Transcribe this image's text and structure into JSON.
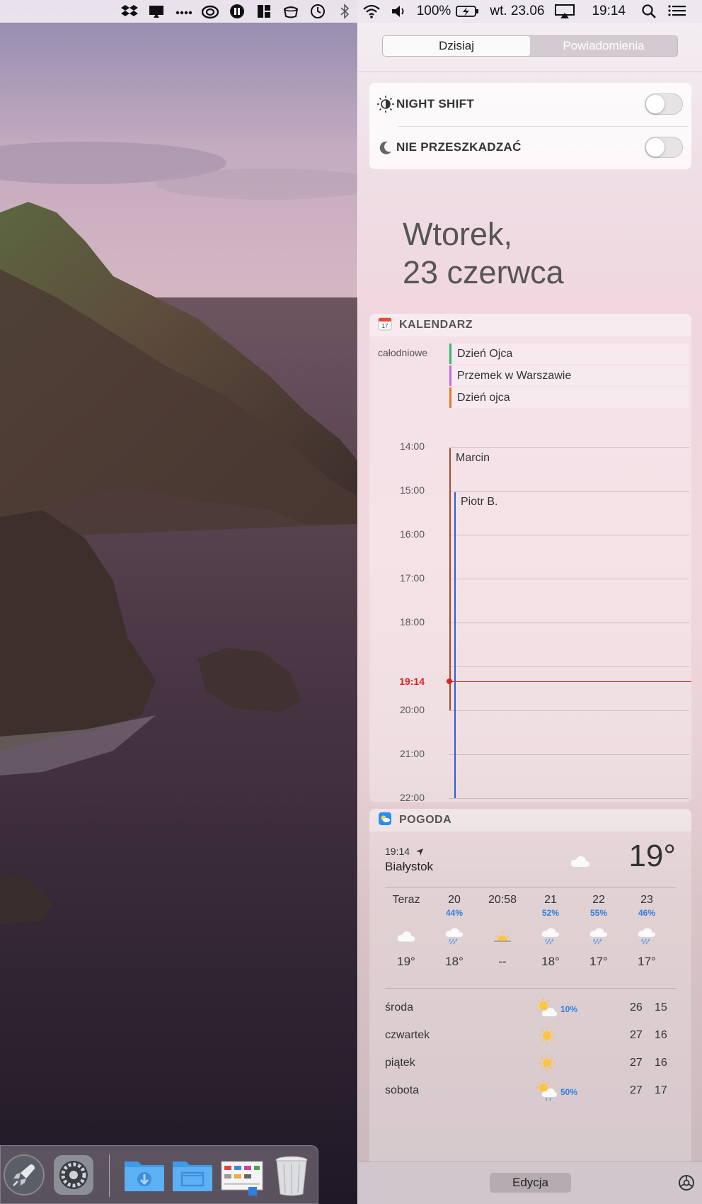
{
  "menubar": {
    "icons": [
      "dropbox-icon",
      "cloudapp-icon",
      "more-dots-icon",
      "creative-cloud-icon",
      "pause-icon",
      "layout-icon",
      "coffee-cup-icon",
      "time-machine-icon",
      "bluetooth-icon",
      "wifi-icon",
      "volume-icon",
      "battery-charging-icon",
      "airplay-icon",
      "spotlight-icon",
      "notification-center-icon"
    ],
    "battery": "100%",
    "date": "wt. 23.06",
    "time": "19:14"
  },
  "panel": {
    "tabs": [
      {
        "label": "Dzisiaj",
        "active": true
      },
      {
        "label": "Powiadomienia",
        "active": false
      }
    ],
    "toggles": [
      {
        "label": "NIGHT SHIFT",
        "icon": "night-shift-icon",
        "on": false
      },
      {
        "label": "NIE PRZESZKADZAĆ",
        "icon": "moon-icon",
        "on": false
      }
    ],
    "date_line1": "Wtorek,",
    "date_line2": "23 czerwca"
  },
  "calendar": {
    "title": "KALENDARZ",
    "allday_label": "całodniowe",
    "allday_events": [
      {
        "title": "Dzień Ojca",
        "color": "#3cb371"
      },
      {
        "title": "Przemek w Warszawie",
        "color": "#c86bd6"
      },
      {
        "title": "Dzień ojca",
        "color": "#e07a2a"
      }
    ],
    "hours": [
      "14:00",
      "15:00",
      "16:00",
      "17:00",
      "18:00",
      "20:00",
      "21:00",
      "22:00"
    ],
    "events": [
      {
        "title": "Marcin",
        "color": "#a0492f"
      },
      {
        "title": "Piotr B.",
        "color": "#2f5fd6"
      }
    ],
    "now_label": "19:14",
    "now_color": "#e02020"
  },
  "weather": {
    "title": "POGODA",
    "time": "19:14",
    "city": "Białystok",
    "current_temp": "19°",
    "hourly": [
      {
        "label": "Teraz",
        "precip": "",
        "icon": "cloud-icon",
        "temp": "19°"
      },
      {
        "label": "20",
        "precip": "44%",
        "icon": "rain-icon",
        "temp": "18°"
      },
      {
        "label": "20:58",
        "precip": "",
        "icon": "sunset-icon",
        "temp": "--"
      },
      {
        "label": "21",
        "precip": "52%",
        "icon": "rain-icon",
        "temp": "18°"
      },
      {
        "label": "22",
        "precip": "55%",
        "icon": "rain-icon",
        "temp": "17°"
      },
      {
        "label": "23",
        "precip": "46%",
        "icon": "rain-icon",
        "temp": "17°"
      }
    ],
    "daily": [
      {
        "day": "środa",
        "icon": "partly-cloudy-icon",
        "precip": "10%",
        "hi": "26",
        "lo": "15"
      },
      {
        "day": "czwartek",
        "icon": "sun-icon",
        "precip": "",
        "hi": "27",
        "lo": "16"
      },
      {
        "day": "piątek",
        "icon": "sun-icon",
        "precip": "",
        "hi": "27",
        "lo": "16"
      },
      {
        "day": "sobota",
        "icon": "sun-rain-icon",
        "precip": "50%",
        "hi": "27",
        "lo": "17"
      }
    ]
  },
  "bottom": {
    "edit_label": "Edycja"
  },
  "dock": {
    "items": [
      "launchpad-icon",
      "system-preferences-icon",
      "downloads-folder-icon",
      "folder-icon",
      "screenshots-stack-icon",
      "trash-icon"
    ]
  }
}
